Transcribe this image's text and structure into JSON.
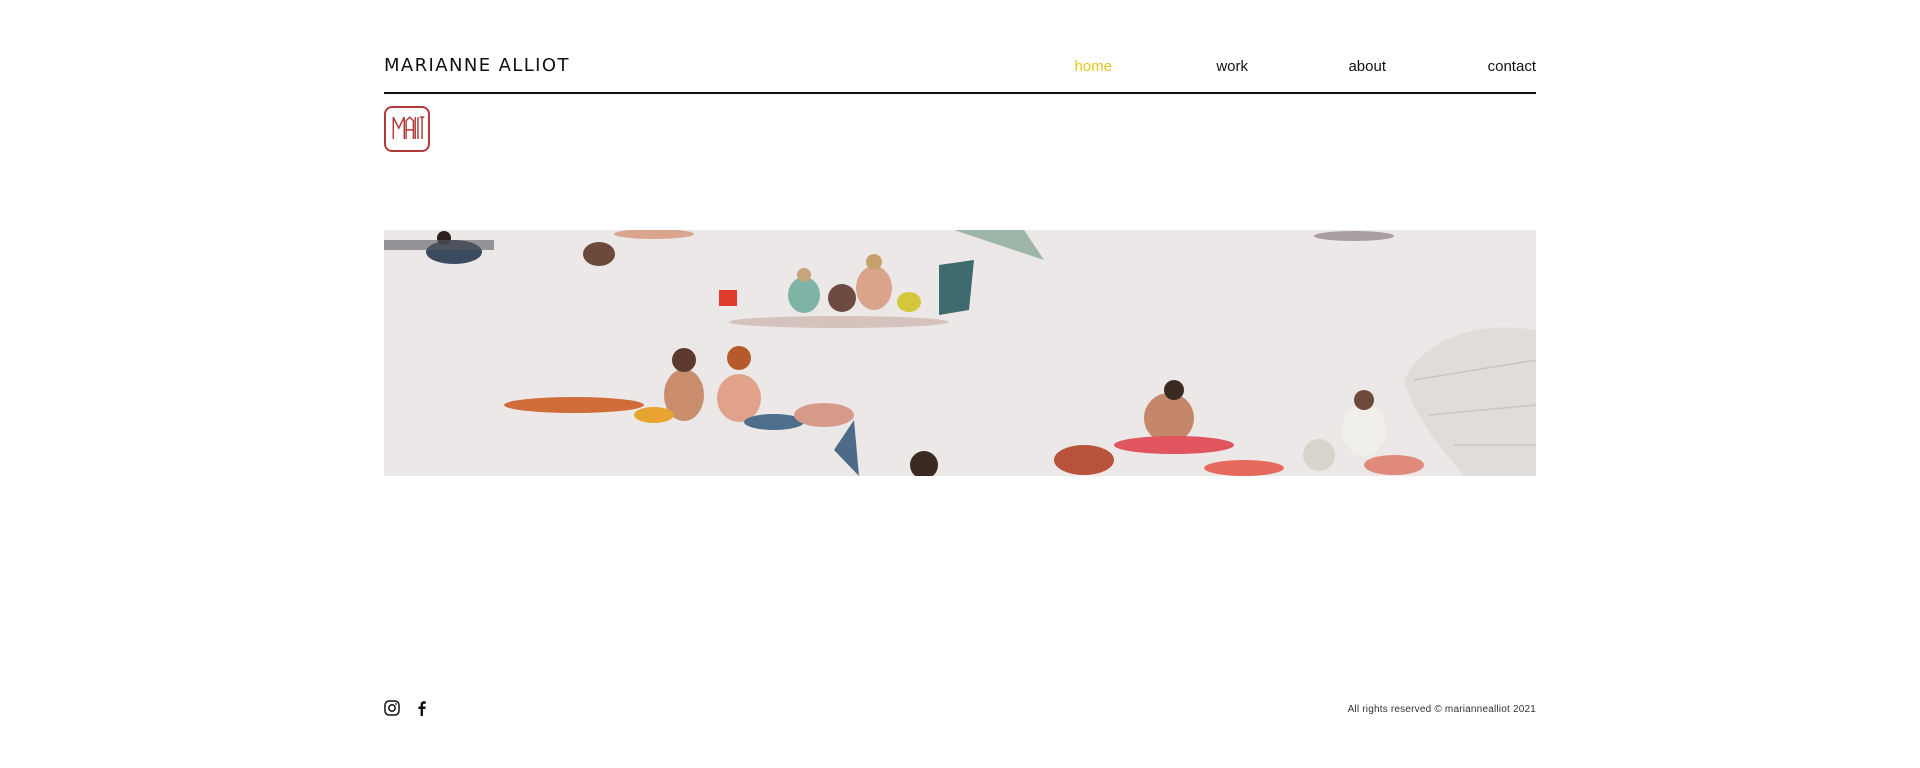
{
  "site": {
    "title": "MARIANNE ALLIOT"
  },
  "nav": {
    "items": [
      {
        "label": "home",
        "active": true
      },
      {
        "label": "work",
        "active": false
      },
      {
        "label": "about",
        "active": false
      },
      {
        "label": "contact",
        "active": false
      }
    ],
    "active_color": "#e6c619"
  },
  "logo": {
    "text": "MALLIOT",
    "color": "#b33a3a"
  },
  "hero": {
    "image": "beach-painting",
    "description_icon": "beach-scene"
  },
  "footer": {
    "social": [
      {
        "icon": "instagram-icon"
      },
      {
        "icon": "facebook-icon"
      }
    ],
    "copyright": "All rights reserved © mariannealliot 2021"
  }
}
